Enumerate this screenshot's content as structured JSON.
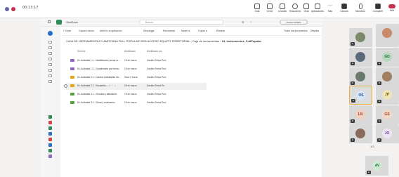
{
  "meeting": {
    "timer": "00:13:17",
    "rec_colors": [
      "#6264a7",
      "#c4314b"
    ],
    "toolbar": [
      {
        "label": "Chat",
        "icon": "chat-icon"
      },
      {
        "label": "Gente",
        "icon": "people-icon"
      },
      {
        "label": "Levantar",
        "icon": "raise-hand-icon"
      },
      {
        "label": "Reacciones",
        "icon": "react-icon"
      },
      {
        "label": "Vista",
        "icon": "view-icon"
      },
      {
        "label": "Aplicaciones",
        "icon": "apps-icon"
      },
      {
        "label": "Más",
        "icon": "more-icon"
      },
      {
        "label": "Cámara",
        "icon": "camera-icon"
      },
      {
        "label": "Micrófono",
        "icon": "mic-icon"
      },
      {
        "label": "Compartir",
        "icon": "share-icon"
      }
    ],
    "leave_label": "Salir"
  },
  "shared": {
    "app_name": "OneDrive",
    "search_placeholder": "Buscar",
    "account": "Acceso limitado",
    "commands": [
      "+ Crear",
      "Copiar vínculo",
      "Abrir en la aplicación",
      "Descargar",
      "Renombrar",
      "Mover a",
      "Copiar a",
      "Eliminar",
      "Todos los documentos",
      "Detalles"
    ],
    "breadcrumb_prefix": "CAJA DE HERRAMIENTAS CAMPESINA FULL POPULAR 2026 ACCESO EQUIPO TERRITORIAL",
    "breadcrumb_mid": "Caja de herramientas",
    "breadcrumb_current": "04. Instrumentos_FullPopular",
    "columns": [
      "Nombre",
      "Modificado",
      "Modificado por"
    ],
    "rows": [
      {
        "name": "04. Actividad 1.1 - Identificación temas re...",
        "date": "18 de marzo",
        "by": "Daniela Serna Ruiz",
        "color": "#8a6bbd"
      },
      {
        "name": "04. Actividad 1.2 - Cuestionario por forma...",
        "date": "18 de marzo",
        "by": "Daniela Serna Ruiz",
        "color": "#8a6bbd"
      },
      {
        "name": "04. Actividad 2.1 - Camino Actividades Ho...",
        "date": "Hace 8 horas",
        "by": "Daniela Serna Ruiz",
        "color": "#e0a21a"
      },
      {
        "name": "04. Actividad 2.2 - Encuentro...",
        "date": "18 de marzo",
        "by": "Daniela Serna Ru",
        "color": "#e0a21a"
      },
      {
        "name": "04. Actividad 3.1 - Vínculos y afectación",
        "date": "18 de marzo",
        "by": "Daniela Serna Ruiz",
        "color": "#5a9e42"
      },
      {
        "name": "04. Actividad 3.2 - Cierre y evaluación",
        "date": "18 de marzo",
        "by": "Daniela Serna Ruiz",
        "color": "#5a9e42"
      }
    ]
  },
  "participants": {
    "tiles": [
      {
        "initials": "",
        "color": "#7a8b6a"
      },
      {
        "initials": "",
        "color": "#c98a6a"
      },
      {
        "initials": "",
        "color": "#5b6a7a"
      },
      {
        "initials": "GD",
        "color": "#b8d8c0"
      },
      {
        "initials": "",
        "color": "#6a7a6a"
      },
      {
        "initials": "",
        "color": "#a08060"
      },
      {
        "initials": "OS",
        "color": "#d7e4f5"
      },
      {
        "initials": "JP",
        "color": "#efe3b8"
      },
      {
        "initials": "LN",
        "color": "#f0d0c0"
      },
      {
        "initials": "GS",
        "color": "#f0d8c8"
      },
      {
        "initials": "",
        "color": "#8a6a5a"
      },
      {
        "initials": "JO",
        "color": "#ece4f4"
      },
      {
        "initials": "AV",
        "color": "#cfe8d4"
      }
    ],
    "pager": "1/3"
  }
}
